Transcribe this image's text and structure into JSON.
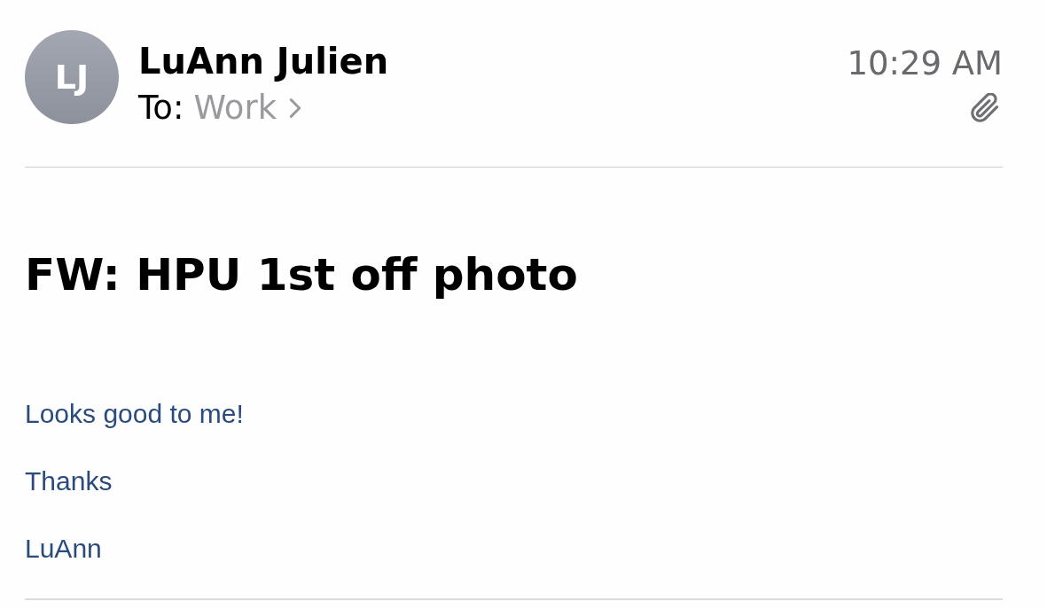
{
  "sender": {
    "initials": "LJ",
    "name": "LuAnn Julien"
  },
  "recipient": {
    "label": "To:",
    "value": "Work"
  },
  "time": "10:29 AM",
  "has_attachment": true,
  "subject": "FW: HPU 1st off photo",
  "body": [
    "Looks good to me!",
    "Thanks",
    "LuAnn"
  ]
}
